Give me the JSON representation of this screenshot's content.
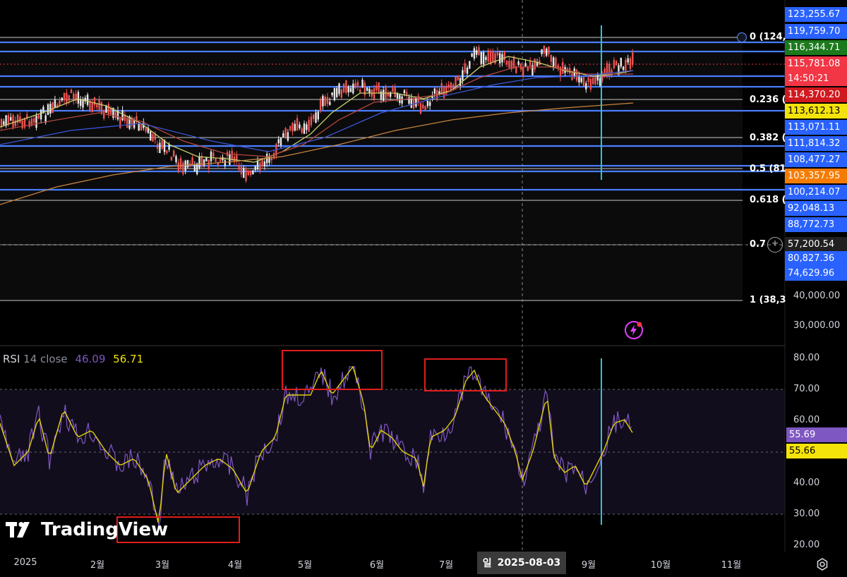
{
  "price_axis": {
    "tags": [
      {
        "text": "123,255.67",
        "bg": "#2962ff"
      },
      {
        "text": "119,759.70",
        "bg": "#2962ff"
      },
      {
        "text": "116,344.71",
        "bg": "#1b7a1b"
      },
      {
        "text": "115,781.08",
        "bg": "#f23645"
      },
      {
        "text": "14:50:21",
        "bg": "#f23645"
      },
      {
        "text": "114,370.20",
        "bg": "#d0191e"
      },
      {
        "text": "113,612.13",
        "bg": "#f4e30a",
        "fg": "#000000"
      },
      {
        "text": "113,071.11",
        "bg": "#2962ff"
      },
      {
        "text": "111,814.32",
        "bg": "#2962ff"
      },
      {
        "text": "108,477.27",
        "bg": "#2962ff"
      },
      {
        "text": "103,357.95",
        "bg": "#f57c00"
      },
      {
        "text": "100,214.07",
        "bg": "#2962ff"
      },
      {
        "text": "92,048.13",
        "bg": "#2962ff"
      },
      {
        "text": "88,772.73",
        "bg": "#2962ff"
      },
      {
        "text": "57,200.54",
        "bg": "#202020"
      },
      {
        "text": "80,827.36",
        "bg": "#2962ff"
      },
      {
        "text": "74,629.96",
        "bg": "#2962ff"
      }
    ],
    "plain_labels": [
      "40,000.00",
      "30,000.00"
    ]
  },
  "fib_levels": [
    {
      "label": "0 (124,"
    },
    {
      "label": "0.236 ("
    },
    {
      "label": "0.382 ("
    },
    {
      "label": "0.5 (81"
    },
    {
      "label": "0.618 ("
    },
    {
      "label": "0.7"
    },
    {
      "label": "1 (38,3"
    }
  ],
  "rsi": {
    "name": "RSI",
    "params": "14 close",
    "value": "46.09",
    "ma_value": "56.71",
    "axis_labels": [
      "80.00",
      "70.00",
      "60.00",
      "40.00",
      "30.00",
      "20.00"
    ],
    "tag_rsi": "55.69",
    "tag_ma": "55.66",
    "colors": {
      "rsi": "#7e57c2",
      "ma": "#f4e30a"
    }
  },
  "time_axis": {
    "months": [
      "2025",
      "2월",
      "3월",
      "4월",
      "5월",
      "6월",
      "7월",
      "일",
      "9월",
      "10월",
      "11월"
    ],
    "crosshair_date": "2025-08-03"
  },
  "logo_text": "TradingView"
}
